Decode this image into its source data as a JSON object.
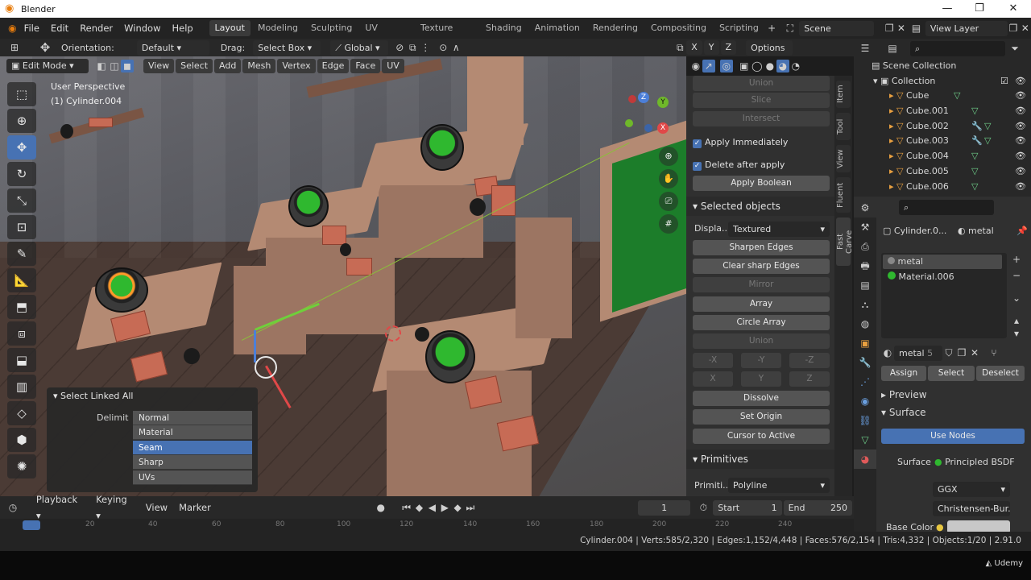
{
  "app": {
    "title": "Blender"
  },
  "menubar": {
    "items": [
      "File",
      "Edit",
      "Render",
      "Window",
      "Help"
    ],
    "workspaces": [
      "Layout",
      "Modeling",
      "Sculpting",
      "UV Editing",
      "Texture Paint",
      "Shading",
      "Animation",
      "Rendering",
      "Compositing",
      "Scripting"
    ],
    "scene": "Scene",
    "view_layer": "View Layer"
  },
  "tool_header": {
    "orientation_label": "Orientation:",
    "orientation_value": "Default",
    "drag_label": "Drag:",
    "drag_value": "Select Box",
    "transform_value": "Global",
    "axes": [
      "X",
      "Y",
      "Z"
    ],
    "options": "Options"
  },
  "view_header": {
    "mode": "Edit Mode",
    "menus": [
      "View",
      "Select",
      "Add",
      "Mesh",
      "Vertex",
      "Edge",
      "Face",
      "UV"
    ]
  },
  "viewport": {
    "perspective": "User Perspective",
    "object": "(1) Cylinder.004",
    "gizmo_axes": [
      "X",
      "Y",
      "Z"
    ],
    "accent_green": "#2fb82f"
  },
  "operator_panel": {
    "title": "Select Linked All",
    "delimit_label": "Delimit",
    "options": [
      "Normal",
      "Material",
      "Seam",
      "Sharp",
      "UVs"
    ],
    "selected": "Seam"
  },
  "npanel": {
    "tabs": [
      "Item",
      "Tool",
      "View",
      "Fluent",
      "Fast Carve"
    ],
    "top_buttons": [
      "Union",
      "Slice",
      "Intersect"
    ],
    "apply_immediately": "Apply Immediately",
    "delete_after_apply": "Delete after apply",
    "apply_boolean": "Apply Boolean",
    "selected_objects": "Selected objects",
    "display_label": "Displa...",
    "display_value": "Textured",
    "buttons": [
      "Sharpen Edges",
      "Clear sharp Edges",
      "Mirror",
      "Array",
      "Circle Array",
      "Union"
    ],
    "axis_row1": [
      "-X",
      "-Y",
      "-Z"
    ],
    "axis_row2": [
      "X",
      "Y",
      "Z"
    ],
    "buttons2": [
      "Dissolve",
      "Set Origin",
      "Cursor to Active"
    ],
    "primitives": "Primitives",
    "primitive_label": "Primiti...",
    "primitive_value": "Polyline"
  },
  "outliner": {
    "scene_collection": "Scene Collection",
    "collection": "Collection",
    "objects": [
      "Cube",
      "Cube.001",
      "Cube.002",
      "Cube.003",
      "Cube.004",
      "Cube.005",
      "Cube.006"
    ]
  },
  "properties": {
    "object_name": "Cylinder.0...",
    "material_name": "metal",
    "slots": [
      "metal",
      "Material.006"
    ],
    "slot_colors": [
      "#5a5a5a",
      "#2fb82f"
    ],
    "material_field": "metal",
    "user_count": "5",
    "assign": "Assign",
    "select": "Select",
    "deselect": "Deselect",
    "preview": "Preview",
    "surface_section": "Surface",
    "use_nodes": "Use Nodes",
    "surface_label": "Surface",
    "surface_value": "Principled BSDF",
    "distribution": "GGX",
    "subsurface": "Christensen-Bur...",
    "base_color_label": "Base Color"
  },
  "timeline": {
    "menus": [
      "Playback",
      "Keying",
      "View",
      "Marker"
    ],
    "current_frame": "1",
    "start_label": "Start",
    "start_value": "1",
    "end_label": "End",
    "end_value": "250",
    "ruler": [
      "20",
      "40",
      "60",
      "80",
      "100",
      "120",
      "140",
      "160",
      "180",
      "200",
      "220",
      "240"
    ]
  },
  "statusbar": {
    "text": "Cylinder.004 | Verts:585/2,320 | Edges:1,152/4,448 | Faces:576/2,154 | Tris:4,332 | Objects:1/20 | 2.91.0"
  },
  "watermark": "Udemy"
}
